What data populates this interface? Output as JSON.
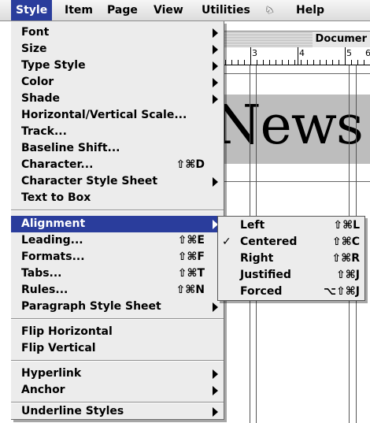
{
  "menubar": {
    "items": [
      {
        "label": "Style",
        "active": true
      },
      {
        "label": "Item"
      },
      {
        "label": "Page"
      },
      {
        "label": "View"
      },
      {
        "label": "Utilities"
      },
      {
        "label": "♘",
        "icon": "script-icon"
      },
      {
        "label": "Help"
      }
    ]
  },
  "document": {
    "title": "Documer",
    "ruler_numbers": [
      "3",
      "4",
      "5",
      "6"
    ],
    "masthead": "News"
  },
  "style_menu": {
    "items": [
      {
        "label": "Font",
        "submenu": true
      },
      {
        "label": "Size",
        "submenu": true
      },
      {
        "label": "Type Style",
        "submenu": true
      },
      {
        "label": "Color",
        "submenu": true
      },
      {
        "label": "Shade",
        "submenu": true
      },
      {
        "label": "Horizontal/Vertical Scale..."
      },
      {
        "label": "Track..."
      },
      {
        "label": "Baseline Shift..."
      },
      {
        "label": "Character...",
        "shortcut": "⇧⌘D"
      },
      {
        "label": "Character Style Sheet",
        "submenu": true
      },
      {
        "label": "Text to Box"
      },
      {
        "label": "Alignment",
        "submenu": true,
        "highlighted": true
      },
      {
        "label": "Leading...",
        "shortcut": "⇧⌘E"
      },
      {
        "label": "Formats...",
        "shortcut": "⇧⌘F"
      },
      {
        "label": "Tabs...",
        "shortcut": "⇧⌘T"
      },
      {
        "label": "Rules...",
        "shortcut": "⇧⌘N"
      },
      {
        "label": "Paragraph Style Sheet",
        "submenu": true
      },
      {
        "label": "Flip Horizontal"
      },
      {
        "label": "Flip Vertical"
      },
      {
        "label": "Hyperlink",
        "submenu": true
      },
      {
        "label": "Anchor",
        "submenu": true
      },
      {
        "label": "Underline Styles",
        "submenu": true
      }
    ]
  },
  "alignment_submenu": {
    "items": [
      {
        "label": "Left",
        "shortcut": "⇧⌘L",
        "checked": false
      },
      {
        "label": "Centered",
        "shortcut": "⇧⌘C",
        "checked": true
      },
      {
        "label": "Right",
        "shortcut": "⇧⌘R",
        "checked": false
      },
      {
        "label": "Justified",
        "shortcut": "⇧⌘J",
        "checked": false
      },
      {
        "label": "Forced",
        "shortcut": "⌥⇧⌘J",
        "checked": false
      }
    ],
    "check_mark": "✓"
  },
  "colors": {
    "highlight": "#2a3d9c",
    "menu_bg": "#ececec"
  }
}
